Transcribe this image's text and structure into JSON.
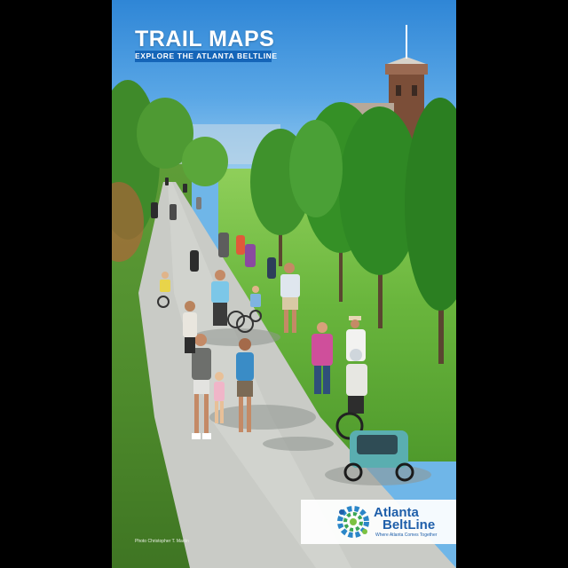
{
  "cover": {
    "title": "TRAIL MAPS",
    "subtitle": "EXPLORE THE ATLANTA BELTLINE",
    "photo_credit": "Photo Christopher T. Martin"
  },
  "logo": {
    "line1": "Atlanta",
    "line2": "BeltLine",
    "tagline": "Where Atlanta Comes Together",
    "colors": [
      "#1f5faa",
      "#3aa655",
      "#7cc242",
      "#2b86c8"
    ]
  },
  "photo": {
    "subject": "people-walking-and-cycling-on-trail",
    "colors": {
      "sky": "#4c9ee0",
      "grass": "#6ab63d",
      "path": "#c9cbc6"
    }
  }
}
